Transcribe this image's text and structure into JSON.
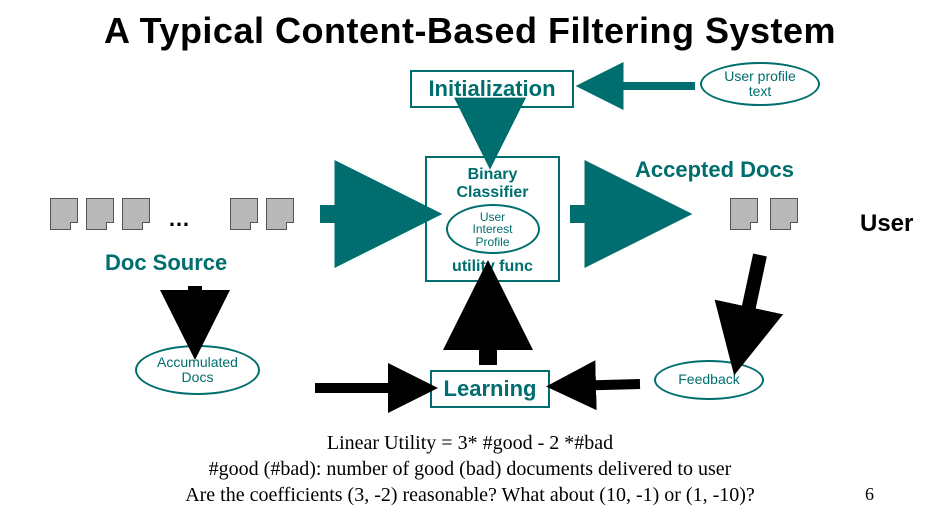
{
  "title": "A Typical Content-Based Filtering System",
  "initialization": "Initialization",
  "classifier": {
    "line1": "Binary",
    "line2": "Classifier",
    "profile_l1": "User",
    "profile_l2": "Interest",
    "profile_l3": "Profile",
    "utility": "utility func"
  },
  "learning": "Learning",
  "user_profile": {
    "l1": "User profile",
    "l2": "text"
  },
  "accumulated": {
    "l1": "Accumulated",
    "l2": "Docs"
  },
  "feedback": "Feedback",
  "doc_source": "Doc Source",
  "accepted_docs": "Accepted Docs",
  "user": "User",
  "dots": "…",
  "footer": {
    "l1": "Linear Utility = 3* #good - 2 *#bad",
    "l2": "#good (#bad):  number of good (bad) documents delivered to user",
    "l3": "Are the coefficients (3, -2) reasonable? What about (10, -1) or (1, -10)?"
  },
  "slide_number": "6"
}
